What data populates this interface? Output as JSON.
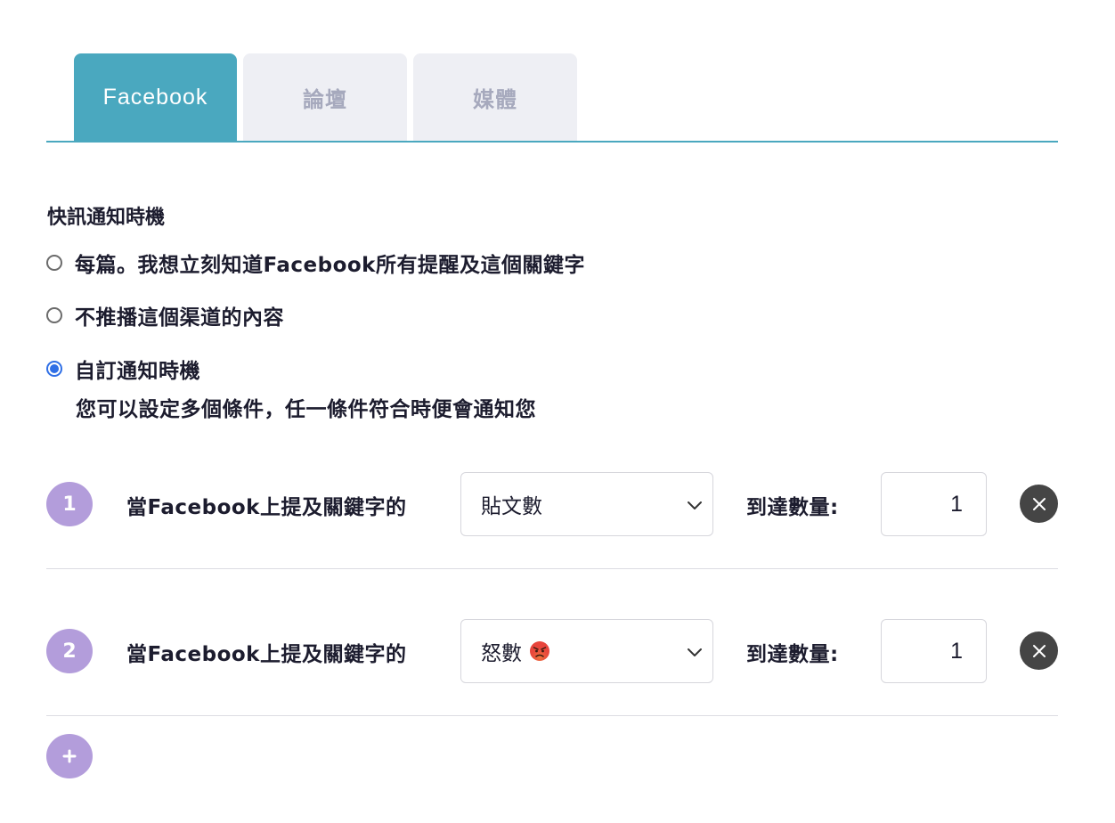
{
  "tabs": [
    {
      "label": "Facebook",
      "active": true
    },
    {
      "label": "論壇",
      "active": false
    },
    {
      "label": "媒體",
      "active": false
    }
  ],
  "section": {
    "title": "快訊通知時機",
    "options": [
      {
        "label": "每篇。我想立刻知道Facebook所有提醒及這個關鍵字",
        "checked": false
      },
      {
        "label": "不推播這個渠道的內容",
        "checked": false
      },
      {
        "label": "自訂通知時機",
        "checked": true,
        "description": "您可以設定多個條件，任一條件符合時便會通知您"
      }
    ]
  },
  "conditions": [
    {
      "number": "1",
      "text": "當Facebook上提及關鍵字的",
      "metric": "貼文數",
      "metric_icon": "",
      "target_label": "到達數量:",
      "target_value": "1"
    },
    {
      "number": "2",
      "text": "當Facebook上提及關鍵字的",
      "metric": "怒數",
      "metric_icon": "angry-face-emoji",
      "target_label": "到達數量:",
      "target_value": "1"
    }
  ],
  "add_button": {
    "icon": "plus-icon"
  },
  "colors": {
    "accent": "#4aa8bf",
    "tab_inactive_bg": "#eeeff4",
    "tab_inactive_text": "#a6a9bd",
    "badge": "#b39ddb",
    "radio_checked": "#2f6fe6",
    "remove_button": "#454545"
  }
}
